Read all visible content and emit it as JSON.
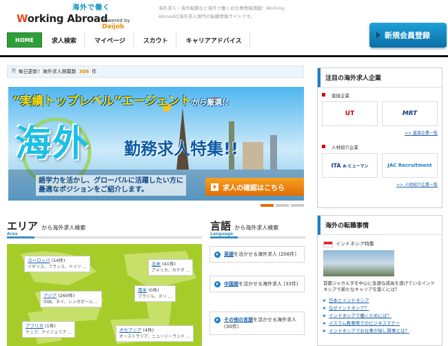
{
  "header": {
    "logo_jp": "海外で働く",
    "logo_main_1": "W",
    "logo_main_2": "orking Abroad",
    "powered_by": "Powered by",
    "powered_brand": "Daijob",
    "tagline": "海外求人・海外転職など海外で働くお仕事情報満載！Working Abroadは海外求人専門の転職情報サイトです。",
    "register_button": "新規会員登録"
  },
  "nav": [
    {
      "label": "HOME",
      "name": "nav-home"
    },
    {
      "label": "求人検索",
      "name": "nav-job-search"
    },
    {
      "label": "マイページ",
      "name": "nav-mypage"
    },
    {
      "label": "スカウト",
      "name": "nav-scout"
    },
    {
      "label": "キャリアアドバイス",
      "name": "nav-career-advice"
    }
  ],
  "notice": {
    "text": "毎日更新！海外求人掲載数",
    "count": "306",
    "unit": "件"
  },
  "banner": {
    "top_quote": "“実績トップレベル”エージェント",
    "top_suffix": "から厳選!!",
    "big_text": "海外",
    "sub_text": "勤務求人特集!!",
    "desc_line1": "語学力を活かし、グローバルに活躍したい方に",
    "desc_line2": "最適なポジションをご紹介します。",
    "button": "求人の確認はこちら"
  },
  "area": {
    "title": "エリア",
    "subtitle": "から海外求人検索",
    "en": "Area",
    "regions": [
      {
        "name": "ヨーロッパ",
        "count": "(14件)",
        "countries": "イギリス、フランス、ドイツ ..."
      },
      {
        "name": "北米",
        "count": "(41件)",
        "countries": "アメリカ、カナダ ..."
      },
      {
        "name": "アジア",
        "count": "(260件)",
        "countries": "中国、タイ、シンガポール ..."
      },
      {
        "name": "南米",
        "count": "(0件)",
        "countries": "ブラジル、チリ ..."
      },
      {
        "name": "アフリカ",
        "count": "(1件)",
        "countries": "ケニア、ナイジェリア ..."
      },
      {
        "name": "オセアニア",
        "count": "(4件)",
        "countries": "オーストラリア、ニュージーランド ..."
      }
    ]
  },
  "lang": {
    "title": "言語",
    "subtitle": "から海外求人検索",
    "en": "Language",
    "items": [
      {
        "name": "英語",
        "suffix": "を活かせる海外求人 (206件)"
      },
      {
        "name": "中国語",
        "suffix": "を活かせる海外求人 (33件)"
      },
      {
        "name": "その他の言語",
        "suffix": "を活かせる海外求人 (30件)"
      }
    ]
  },
  "featured": {
    "title": "注目の海外求人企業",
    "direct": "直接企業",
    "direct_more": ">> 直接企業一覧",
    "agency": "人材紹介企業",
    "agency_more": ">> 人材紹介企業一覧",
    "logos": [
      "UT",
      "MRT",
      "ITA",
      "A-ヒューマン",
      "JAC Recruitment"
    ]
  },
  "career": {
    "title": "海外の転職事情",
    "country": "インドネシア特集",
    "desc": "首都ジャカルタを中心に急激な成長を遂げているインドネシアで新たなキャリアを築くには？",
    "links": [
      "日本とインドネシア",
      "なぜインドネシア？",
      "インドネシアで働くためには？",
      "イスラム教事情でのビジネスマナー",
      "インドネシアでお仕事が探し隊事とは？"
    ]
  },
  "colors": {
    "accent": "#1a7fc8",
    "home": "#2e9e3a",
    "orange": "#e06d08"
  }
}
